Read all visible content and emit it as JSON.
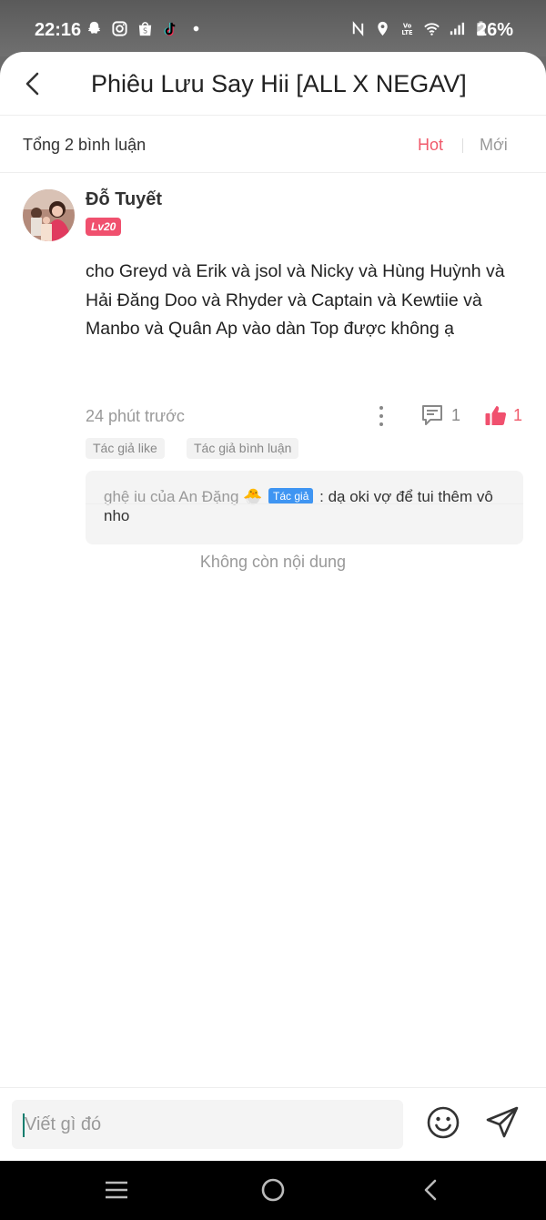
{
  "status_bar": {
    "time": "22:16",
    "battery": "26%",
    "left_icons": [
      "snapchat-icon",
      "instagram-icon",
      "shopee-icon",
      "tiktok-icon",
      "dot-icon"
    ],
    "right_icons": [
      "nfc-icon",
      "location-icon",
      "volte-icon",
      "wifi-icon",
      "signal-icon",
      "battery-icon"
    ]
  },
  "header": {
    "title": "Phiêu Lưu Say Hii [ALL X NEGAV]"
  },
  "comments_bar": {
    "total": "Tổng 2 bình luận",
    "sort_hot": "Hot",
    "sort_new": "Mới"
  },
  "comment": {
    "author": "Đỗ Tuyết",
    "level": "Lv20",
    "body": "cho Greyd và Erik và jsol và Nicky và Hùng Huỳnh và Hải Đăng Doo và Rhyder và Captain và Kewtiie và Manbo và Quân Ap vào dàn Top được không ạ",
    "time": "24 phút trước",
    "reply_count": "1",
    "like_count": "1",
    "tags": [
      "Tác giả like",
      "Tác giả bình luận"
    ],
    "reply": {
      "author": "ghệ iu của An Đặng 🐣",
      "badge": "Tác giả",
      "separator": ":",
      "text": "dạ oki vợ để tui thêm vô nho"
    }
  },
  "end_message": "Không còn nội dung",
  "input": {
    "placeholder": "Viết gì đó"
  },
  "colors": {
    "accent": "#f05a6b",
    "author_badge": "#3f95f2",
    "level_badge": "#f0506e"
  }
}
